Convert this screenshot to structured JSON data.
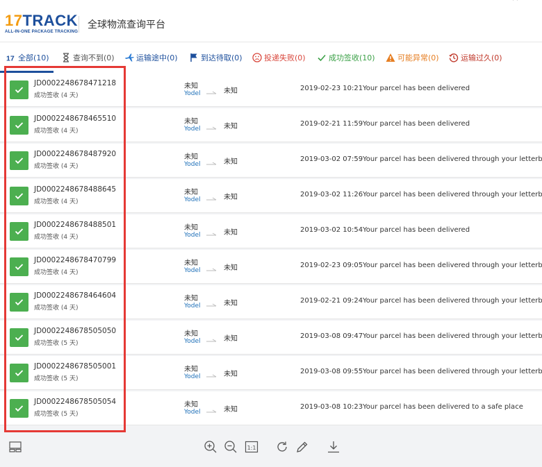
{
  "window": {
    "close_glyph": "×"
  },
  "header": {
    "logo_17": "17",
    "logo_track": "TRACK",
    "logo_sub": "ALL-IN-ONE PACKAGE TRACKING",
    "title": "全球物流查询平台"
  },
  "tabs": [
    {
      "label": "全部(10)",
      "icon": "17track-logo-icon",
      "active": true
    },
    {
      "label": "查询不到(0)",
      "icon": "hourglass-icon"
    },
    {
      "label": "运输途中(0)",
      "icon": "airplane-icon"
    },
    {
      "label": "到达待取(0)",
      "icon": "flag-icon"
    },
    {
      "label": "投递失败(0)",
      "icon": "sad-face-icon"
    },
    {
      "label": "成功签收(10)",
      "icon": "checkmark-icon"
    },
    {
      "label": "可能异常(0)",
      "icon": "warning-icon"
    },
    {
      "label": "运输过久(0)",
      "icon": "clock-history-icon"
    }
  ],
  "colors": {
    "brand_blue": "#1d4f9c",
    "brand_orange": "#f39c12",
    "success_green": "#4caf50",
    "highlight_red": "#e53935"
  },
  "packages": [
    {
      "tracking": "JD0002248678471218",
      "status": "成功签收 (4 天)",
      "origin": "未知",
      "carrier": "Yodel",
      "dest": "未知",
      "time": "2019-02-23 10:21",
      "message": "Your parcel has been delivered"
    },
    {
      "tracking": "JD0002248678465510",
      "status": "成功签收 (4 天)",
      "origin": "未知",
      "carrier": "Yodel",
      "dest": "未知",
      "time": "2019-02-21 11:59",
      "message": "Your parcel has been delivered"
    },
    {
      "tracking": "JD0002248678487920",
      "status": "成功签收 (4 天)",
      "origin": "未知",
      "carrier": "Yodel",
      "dest": "未知",
      "time": "2019-03-02 07:59",
      "message": "Your parcel has been delivered through your letterbox"
    },
    {
      "tracking": "JD0002248678488645",
      "status": "成功签收 (4 天)",
      "origin": "未知",
      "carrier": "Yodel",
      "dest": "未知",
      "time": "2019-03-02 11:26",
      "message": "Your parcel has been delivered through your letterbox"
    },
    {
      "tracking": "JD0002248678488501",
      "status": "成功签收 (4 天)",
      "origin": "未知",
      "carrier": "Yodel",
      "dest": "未知",
      "time": "2019-03-02 10:54",
      "message": "Your parcel has been delivered"
    },
    {
      "tracking": "JD0002248678470799",
      "status": "成功签收 (4 天)",
      "origin": "未知",
      "carrier": "Yodel",
      "dest": "未知",
      "time": "2019-02-23 09:05",
      "message": "Your parcel has been delivered through your letterbox"
    },
    {
      "tracking": "JD0002248678464604",
      "status": "成功签收 (4 天)",
      "origin": "未知",
      "carrier": "Yodel",
      "dest": "未知",
      "time": "2019-02-21 09:24",
      "message": "Your parcel has been delivered through your letterbox"
    },
    {
      "tracking": "JD0002248678505050",
      "status": "成功签收 (5 天)",
      "origin": "未知",
      "carrier": "Yodel",
      "dest": "未知",
      "time": "2019-03-08 09:47",
      "message": "Your parcel has been delivered through your letterbox"
    },
    {
      "tracking": "JD0002248678505001",
      "status": "成功签收 (5 天)",
      "origin": "未知",
      "carrier": "Yodel",
      "dest": "未知",
      "time": "2019-03-08 09:55",
      "message": "Your parcel has been delivered through your letterbox"
    },
    {
      "tracking": "JD0002248678505054",
      "status": "成功签收 (5 天)",
      "origin": "未知",
      "carrier": "Yodel",
      "dest": "未知",
      "time": "2019-03-08 10:23",
      "message": "Your parcel has been delivered to a safe place"
    }
  ],
  "toolbar": {
    "items": [
      "layout-toggle-icon",
      "zoom-in-icon",
      "zoom-out-icon",
      "actual-size-icon",
      "rotate-icon",
      "edit-pencil-icon",
      "download-icon"
    ],
    "actual_size_label": "1:1"
  }
}
